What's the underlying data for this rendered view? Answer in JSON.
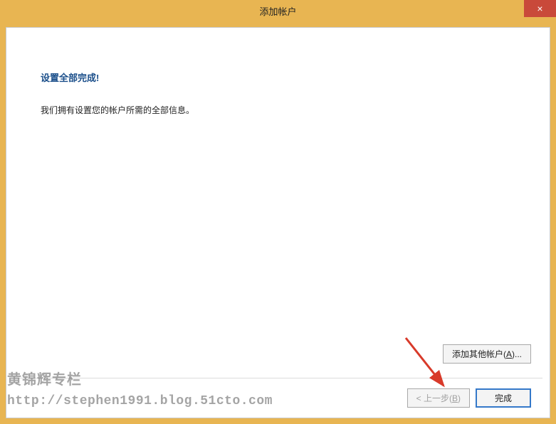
{
  "titlebar": {
    "title": "添加帐户",
    "close_glyph": "×"
  },
  "content": {
    "heading": "设置全部完成!",
    "body": "我们拥有设置您的帐户所需的全部信息。"
  },
  "buttons": {
    "add_other_prefix": "添加其他帐户(",
    "add_other_key": "A",
    "add_other_suffix": ")...",
    "back_prefix": "< 上一步(",
    "back_key": "B",
    "back_suffix": ")",
    "finish": "完成"
  },
  "watermark": {
    "line1": "黄锦辉专栏",
    "line2": "http://stephen1991.blog.51cto.com"
  }
}
